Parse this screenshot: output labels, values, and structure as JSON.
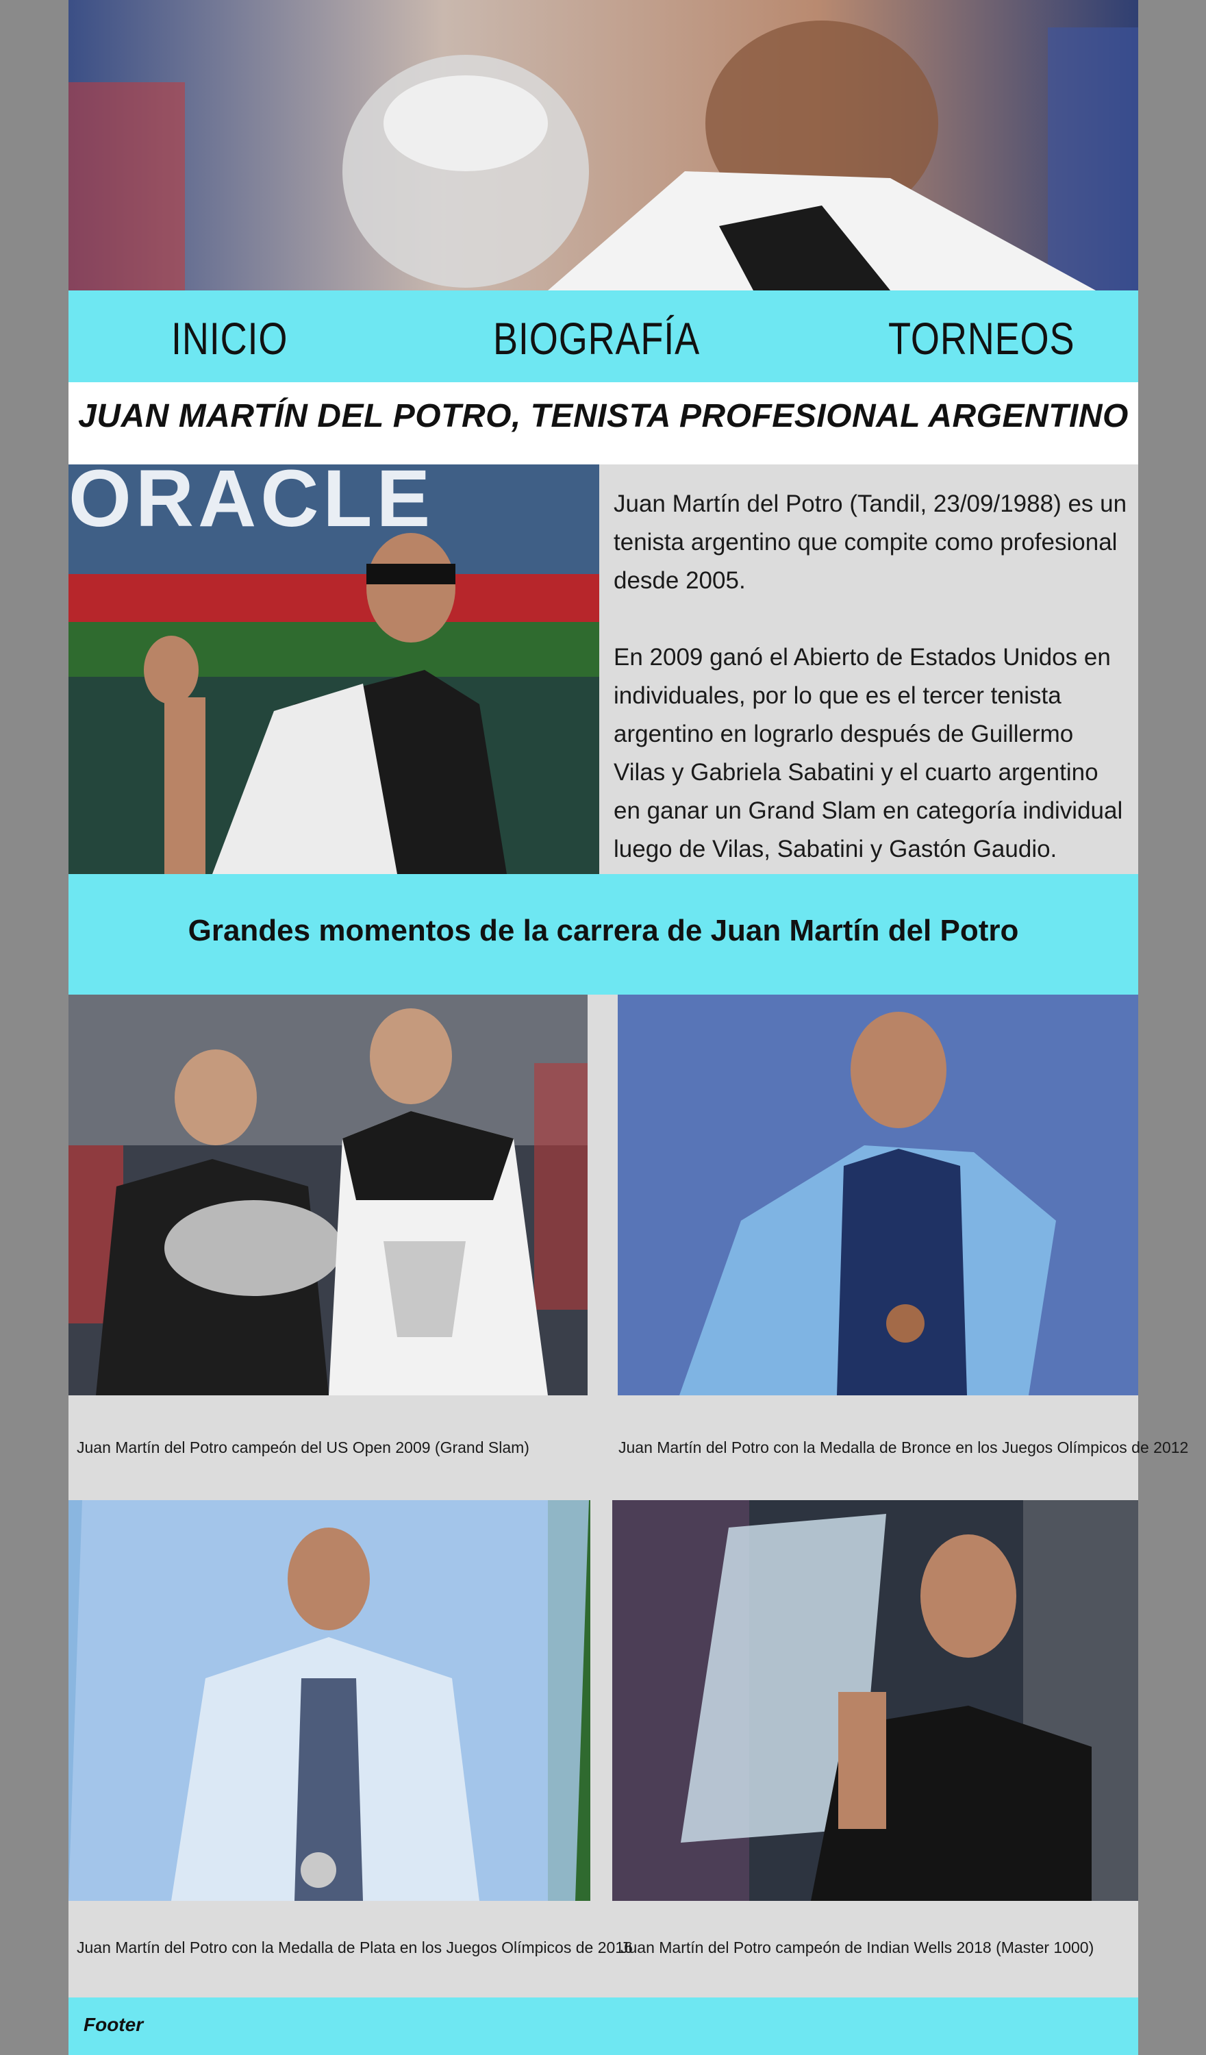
{
  "nav": {
    "items": [
      "INICIO",
      "BIOGRAFÍA",
      "TORNEOS"
    ]
  },
  "header": {
    "title": "JUAN MARTÍN DEL POTRO, TENISTA PROFESIONAL ARGENTINO"
  },
  "bio": {
    "paragraph_1": "Juan Martín del Potro (Tandil, 23/09/1988) es un tenista argentino que compite como profesional desde 2005.",
    "paragraph_2": "En 2009 ganó el Abierto de Estados Unidos  en individuales, por lo que es el tercer tenista argentino en lograrlo después de Guillermo Vilas y Gabriela Sabatini y el cuarto argentino en ganar un Grand Slam en categoría individual luego de Vilas, Sabatini y Gastón Gaudio.",
    "photo_sign": "ORACLE"
  },
  "section": {
    "title": "Grandes momentos de la carrera de Juan Martín del Potro"
  },
  "gallery": {
    "captions": [
      "Juan Martín del Potro campeón del US Open 2009 (Grand Slam)",
      "Juan Martín del Potro con la Medalla de Bronce en los Juegos Olímpicos de 2012",
      "Juan Martín del Potro con la Medalla de Plata en los Juegos Olímpicos de 2016",
      "Juan Martín del Potro campeón de Indian Wells 2018 (Master 1000)"
    ]
  },
  "footer": {
    "label": "Footer"
  },
  "colors": {
    "page_bg": "#8a8a8a",
    "accent": "#6ee7f2",
    "panel": "#dcdcdc"
  }
}
